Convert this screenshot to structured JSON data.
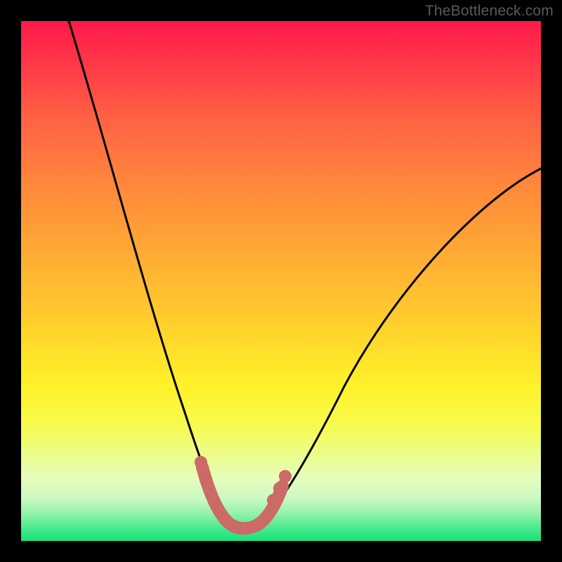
{
  "watermark": "TheBottleneck.com",
  "chart_data": {
    "type": "line",
    "title": "",
    "xlabel": "",
    "ylabel": "",
    "xlim": [
      0,
      100
    ],
    "ylim": [
      0,
      100
    ],
    "grid": false,
    "legend": false,
    "series": [
      {
        "name": "bottleneck-curve",
        "color": "#000000",
        "x": [
          10,
          14,
          18,
          22,
          26,
          29,
          31,
          33,
          35,
          36,
          37,
          38,
          39,
          40,
          41,
          42,
          43,
          44,
          45,
          47,
          50,
          55,
          60,
          65,
          70,
          75,
          80,
          85,
          90,
          95,
          100
        ],
        "y": [
          100,
          88,
          76,
          64,
          52,
          41,
          34,
          27,
          20,
          16,
          12,
          9,
          6,
          4,
          3,
          3,
          3,
          4,
          6,
          9,
          14,
          22,
          30,
          37,
          44,
          50,
          56,
          61,
          66,
          70,
          74
        ]
      },
      {
        "name": "highlight-band",
        "color": "#cb6a67",
        "x": [
          35,
          36,
          37,
          38,
          39,
          40,
          41,
          42,
          43,
          44,
          45,
          46
        ],
        "y": [
          10,
          7,
          5,
          4,
          3,
          3,
          3,
          3,
          4,
          5,
          7,
          10
        ]
      }
    ],
    "annotations": []
  }
}
